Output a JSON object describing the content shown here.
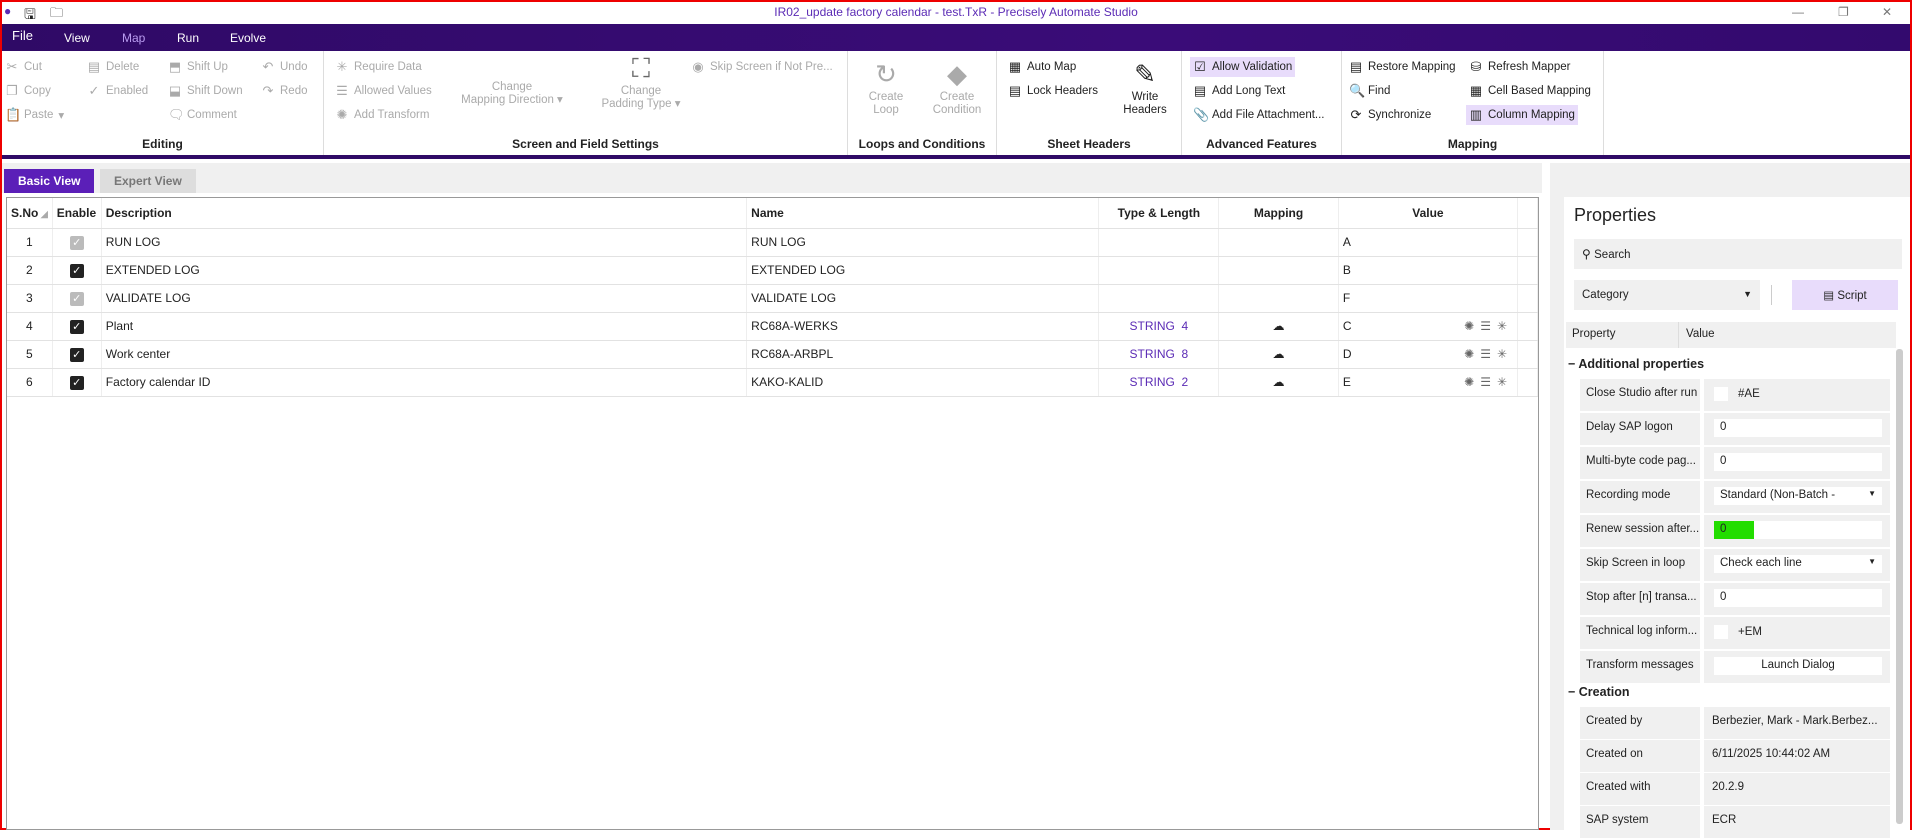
{
  "window": {
    "title": "IR02_update factory calendar - test.TxR - Precisely Automate Studio"
  },
  "menu": [
    "File",
    "View",
    "Map",
    "Run",
    "Evolve"
  ],
  "ribbon": {
    "editing": {
      "label": "Editing",
      "items": [
        "Cut",
        "Copy",
        "Paste",
        "Delete",
        "Enabled",
        "Shift Up",
        "Shift Down",
        "Comment",
        "Undo",
        "Redo"
      ]
    },
    "screen": {
      "label": "Screen and Field Settings",
      "items": [
        "Require Data",
        "Allowed Values",
        "Add Transform",
        "Skip Screen if Not Pre..."
      ],
      "mapping_dir": [
        "Change",
        "Mapping Direction"
      ],
      "padding": [
        "Change",
        "Padding Type"
      ]
    },
    "loops": {
      "label": "Loops and Conditions",
      "create_loop": [
        "Create",
        "Loop"
      ],
      "create_cond": [
        "Create",
        "Condition"
      ]
    },
    "sheet": {
      "label": "Sheet Headers",
      "items": [
        "Auto Map",
        "Lock Headers"
      ],
      "write": [
        "Write",
        "Headers"
      ]
    },
    "advanced": {
      "label": "Advanced Features",
      "items": [
        "Allow Validation",
        "Add Long Text",
        "Add File Attachment..."
      ]
    },
    "mapping": {
      "label": "Mapping",
      "items": [
        "Restore Mapping",
        "Find",
        "Synchronize",
        "Refresh Mapper",
        "Cell Based Mapping",
        "Column Mapping"
      ]
    }
  },
  "tabs": [
    "Basic View",
    "Expert View"
  ],
  "grid": {
    "headers": [
      "S.No",
      "Enable",
      "Description",
      "Name",
      "Type & Length",
      "Mapping",
      "Value"
    ],
    "rows": [
      {
        "sno": "1",
        "enabled": "disabled",
        "desc": "RUN LOG",
        "name": "RUN LOG",
        "type": "",
        "value": "A"
      },
      {
        "sno": "2",
        "enabled": "checked",
        "desc": "EXTENDED LOG",
        "name": "EXTENDED LOG",
        "type": "",
        "value": "B"
      },
      {
        "sno": "3",
        "enabled": "disabled",
        "desc": "VALIDATE LOG",
        "name": "VALIDATE LOG",
        "type": "",
        "value": "F"
      },
      {
        "sno": "4",
        "enabled": "checked",
        "desc": "Plant",
        "name": "RC68A-WERKS",
        "type": "STRING  4",
        "value": "C"
      },
      {
        "sno": "5",
        "enabled": "checked",
        "desc": "Work center",
        "name": "RC68A-ARBPL",
        "type": "STRING  8",
        "value": "D"
      },
      {
        "sno": "6",
        "enabled": "checked",
        "desc": "Factory calendar ID",
        "name": "KAKO-KALID",
        "type": "STRING  2",
        "value": "E"
      }
    ]
  },
  "properties": {
    "title": "Properties",
    "search_placeholder": "Search",
    "category": "Category",
    "script": "Script",
    "col_property": "Property",
    "col_value": "Value",
    "sections": [
      {
        "title": "Additional properties",
        "rows": [
          {
            "label": "Close Studio after run",
            "value": "#AE",
            "kind": "check"
          },
          {
            "label": "Delay SAP logon",
            "value": "0",
            "kind": "input"
          },
          {
            "label": "Multi-byte code pag...",
            "value": "0",
            "kind": "input"
          },
          {
            "label": "Recording mode",
            "value": "Standard (Non-Batch -",
            "kind": "select"
          },
          {
            "label": "Renew session after...",
            "value": "0",
            "kind": "green"
          },
          {
            "label": "Skip Screen in loop",
            "value": "Check each line",
            "kind": "select"
          },
          {
            "label": "Stop after [n] transa...",
            "value": "0",
            "kind": "input"
          },
          {
            "label": "Technical log inform...",
            "value": "+EM",
            "kind": "check"
          },
          {
            "label": "Transform messages",
            "value": "Launch Dialog",
            "kind": "button"
          }
        ]
      },
      {
        "title": "Creation",
        "rows": [
          {
            "label": "Created by",
            "value": "Berbezier, Mark - Mark.Berbez...",
            "kind": "text"
          },
          {
            "label": "Created on",
            "value": "6/11/2025 10:44:02 AM",
            "kind": "text"
          },
          {
            "label": "Created with",
            "value": "20.2.9",
            "kind": "text"
          },
          {
            "label": "SAP system",
            "value": "ECR",
            "kind": "text"
          }
        ]
      }
    ]
  }
}
